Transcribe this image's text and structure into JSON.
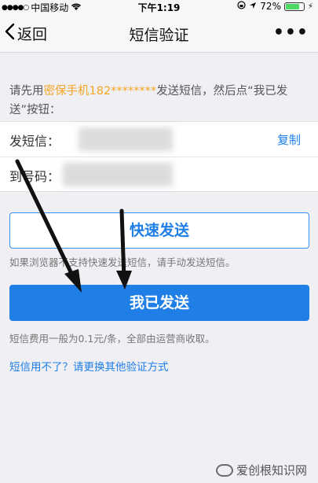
{
  "status_bar": {
    "carrier": "中国移动",
    "time": "下午1:19",
    "battery_pct": "72%",
    "battery_level": 0.72
  },
  "nav": {
    "back_label": "返回",
    "title": "短信验证",
    "more_label": "•••"
  },
  "intro": {
    "prefix": "请先用",
    "phone_label": "密保手机182********",
    "suffix": "发送短信，然后点“我已发送”按钮："
  },
  "fields": {
    "send_label": "发短信：",
    "copy_label": "复制",
    "to_label": "到号码："
  },
  "quick_send_label": "快速发送",
  "quick_send_hint": "如果浏览器不支持快速发送短信，请手动发送短信。",
  "sent_label": "我已发送",
  "fee_hint": "短信费用一般为0.1元/条，全部由运营商收取。",
  "alt_link": "短信用不了？请更换其他验证方式",
  "watermark": "爱创根知识网",
  "colors": {
    "accent": "#1f7fe6",
    "highlight": "#f5a623",
    "background": "#efeff4"
  }
}
